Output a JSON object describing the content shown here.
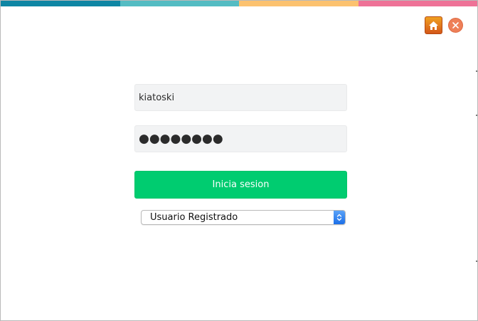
{
  "header": {
    "strip_colors": [
      "#0e86a4",
      "#54bcc3",
      "#fcc26f",
      "#ee7297"
    ],
    "home_icon": "home-icon",
    "close_icon": "close-icon",
    "home_color": "#e0711c",
    "close_color": "#ee7f58"
  },
  "login": {
    "username_value": "kiatoski",
    "password_value": "●●●●●●●●",
    "submit_label": "Inicia sesion",
    "submit_color": "#00cc70",
    "user_type": {
      "selected": "Usuario Registrado",
      "icon": "up-down-chevron-icon"
    }
  }
}
